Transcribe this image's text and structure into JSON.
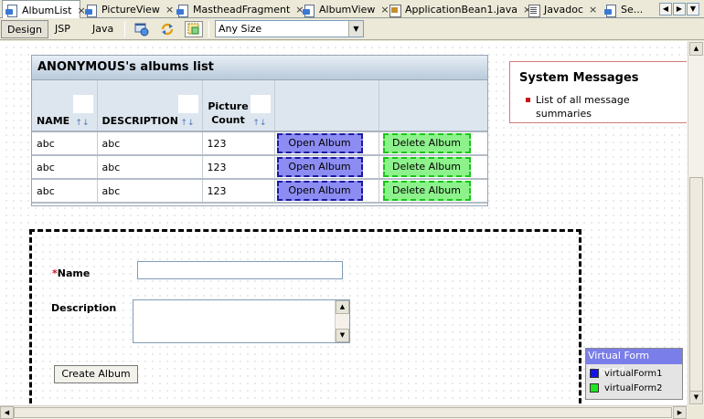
{
  "tabs": [
    {
      "label": "AlbumList",
      "icon": "page-icon",
      "active": true
    },
    {
      "label": "PictureView",
      "icon": "page-icon"
    },
    {
      "label": "MastheadFragment",
      "icon": "page-icon"
    },
    {
      "label": "AlbumView",
      "icon": "page-icon"
    },
    {
      "label": "ApplicationBean1.java",
      "icon": "java-file-icon"
    },
    {
      "label": "Javadoc",
      "icon": "javadoc-icon"
    },
    {
      "label": "Se...",
      "icon": "page-icon"
    }
  ],
  "tab_nav": {
    "left": "◀",
    "right": "▶",
    "list": "▼"
  },
  "close_glyph": "×",
  "toolbar": {
    "design_label": "Design",
    "jsp_label": "JSP",
    "java_label": "Java",
    "size_select": "Any Size"
  },
  "album_table": {
    "title": "ANONYMOUS's albums list",
    "columns": [
      "NAME",
      "DESCRIPTION",
      "Picture Count",
      "",
      ""
    ],
    "rows": [
      {
        "name": "abc",
        "description": "abc",
        "count": "123",
        "open": "Open Album",
        "delete": "Delete Album"
      },
      {
        "name": "abc",
        "description": "abc",
        "count": "123",
        "open": "Open Album",
        "delete": "Delete Album"
      },
      {
        "name": "abc",
        "description": "abc",
        "count": "123",
        "open": "Open Album",
        "delete": "Delete Album"
      }
    ]
  },
  "system_messages": {
    "title": "System Messages",
    "items": [
      "List of all message summaries"
    ]
  },
  "create_form": {
    "required_mark": "*",
    "name_label": "Name",
    "name_value": "",
    "description_label": "Description",
    "description_value": "",
    "create_label": "Create Album"
  },
  "legend": {
    "title": "Virtual Form Legend",
    "items": [
      {
        "label": "virtualForm1",
        "color": "#1414e6"
      },
      {
        "label": "virtualForm2",
        "color": "#1ee61e"
      }
    ]
  },
  "colors": {
    "open_button": "#8c8cf2",
    "delete_button": "#8ef28c",
    "required": "#c8171e"
  }
}
